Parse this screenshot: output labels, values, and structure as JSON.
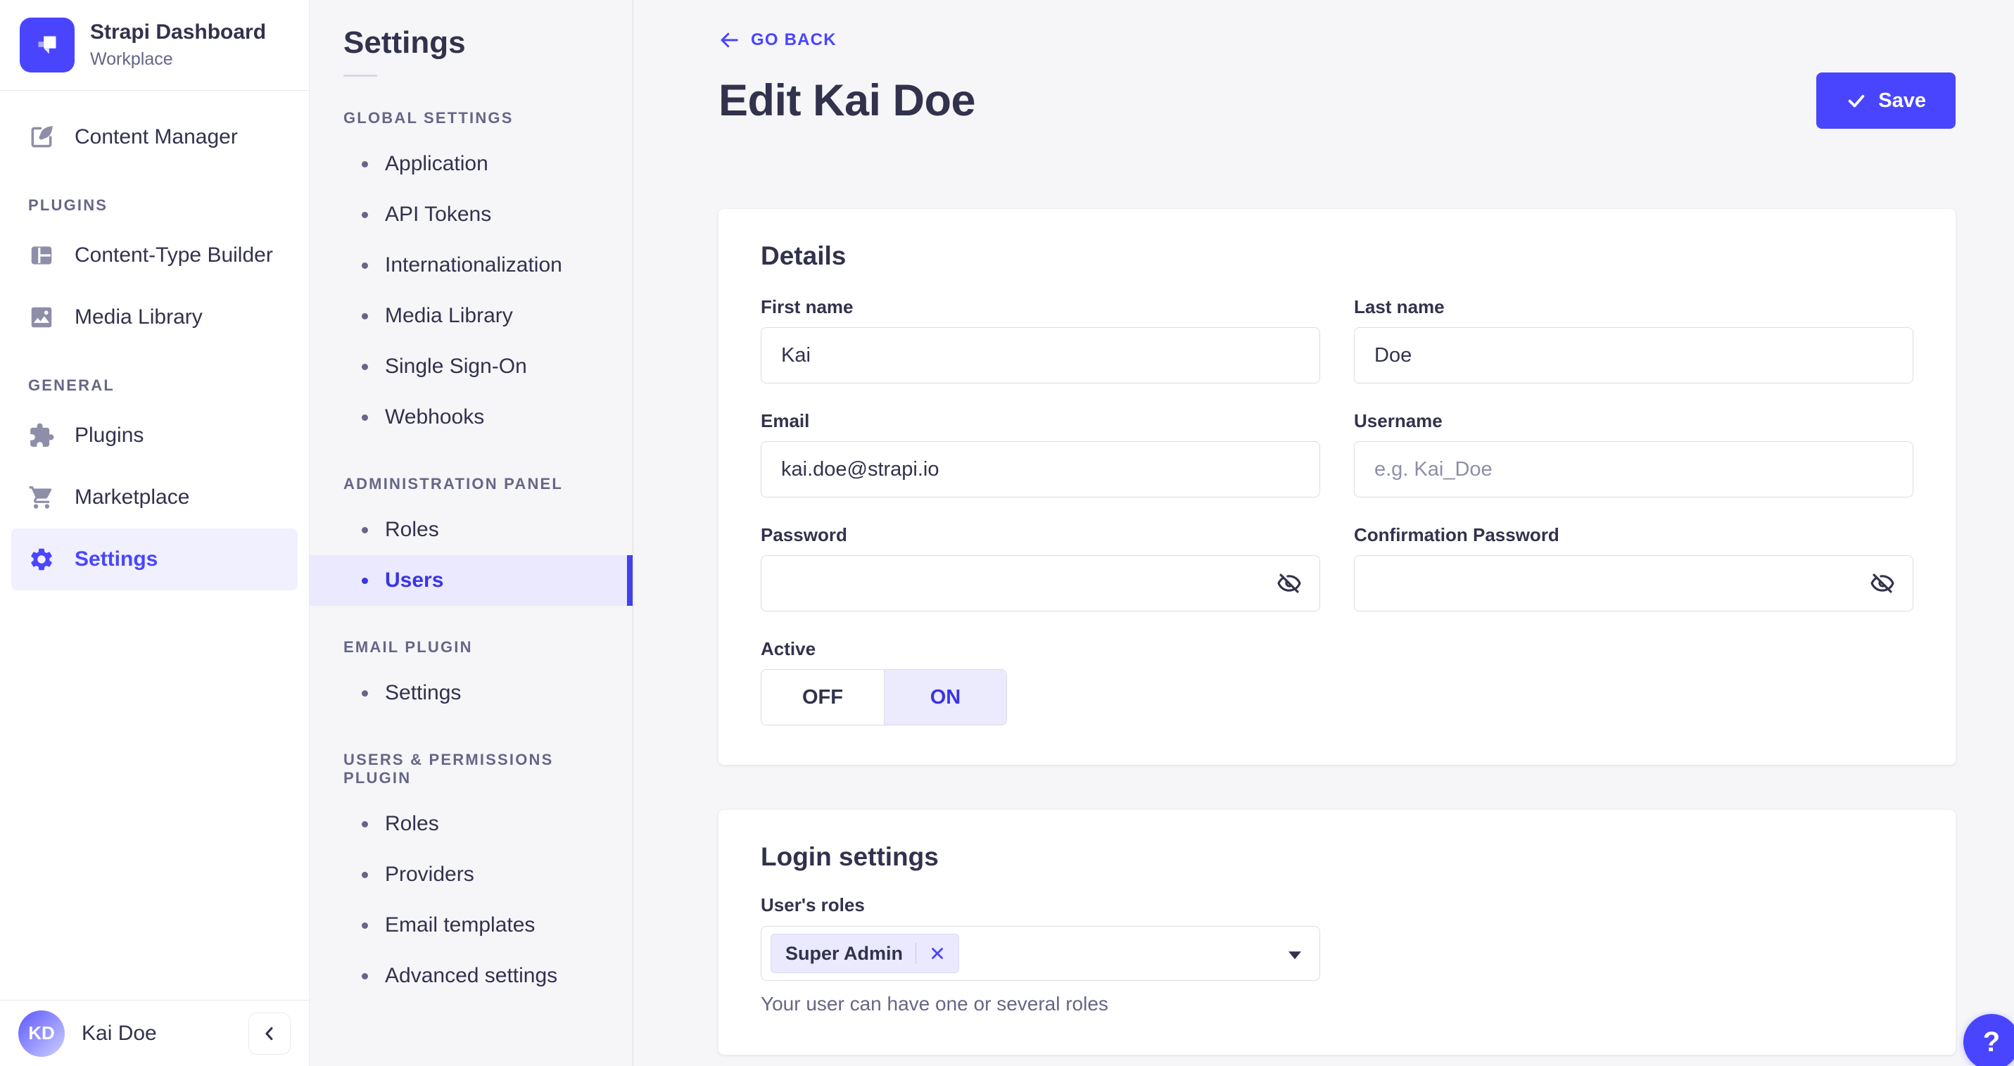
{
  "colors": {
    "primary": "#4945ff",
    "primary_dark": "#3a35e0",
    "primary_light_bg": "#eae9fe",
    "text_dark": "#32324d",
    "text_gray": "#666687",
    "border": "#dcdce4",
    "page_bg": "#f6f6f9"
  },
  "sidebar": {
    "app_title": "Strapi Dashboard",
    "workspace": "Workplace",
    "content_manager": "Content Manager",
    "plugins_heading": "PLUGINS",
    "content_type_builder": "Content-Type Builder",
    "media_library": "Media Library",
    "general_heading": "GENERAL",
    "plugins": "Plugins",
    "marketplace": "Marketplace",
    "settings": "Settings",
    "user_initials": "KD",
    "user_name": "Kai Doe"
  },
  "subnav": {
    "title": "Settings",
    "sections": [
      {
        "heading": "GLOBAL SETTINGS",
        "items": [
          "Application",
          "API Tokens",
          "Internationalization",
          "Media Library",
          "Single Sign-On",
          "Webhooks"
        ]
      },
      {
        "heading": "ADMINISTRATION PANEL",
        "items": [
          "Roles",
          "Users"
        ],
        "active_item": "Users"
      },
      {
        "heading": "EMAIL PLUGIN",
        "items": [
          "Settings"
        ]
      },
      {
        "heading": "USERS & PERMISSIONS PLUGIN",
        "items": [
          "Roles",
          "Providers",
          "Email templates",
          "Advanced settings"
        ]
      }
    ]
  },
  "header": {
    "go_back": "GO BACK",
    "title": "Edit Kai Doe",
    "save": "Save"
  },
  "details_card": {
    "heading": "Details",
    "fields": [
      {
        "label": "First name",
        "value": "Kai"
      },
      {
        "label": "Last name",
        "value": "Doe"
      },
      {
        "label": "Email",
        "value": "kai.doe@strapi.io"
      },
      {
        "label": "Username",
        "placeholder": "e.g. Kai_Doe"
      },
      {
        "label": "Password"
      },
      {
        "label": "Confirmation Password"
      }
    ],
    "active_toggle": {
      "label": "Active",
      "off": "OFF",
      "on": "ON",
      "selected": "ON"
    }
  },
  "login_card": {
    "heading": "Login settings",
    "roles_label": "User's roles",
    "role_tag": "Super Admin",
    "helper": "Your user can have one or several roles"
  },
  "help_button": "?"
}
